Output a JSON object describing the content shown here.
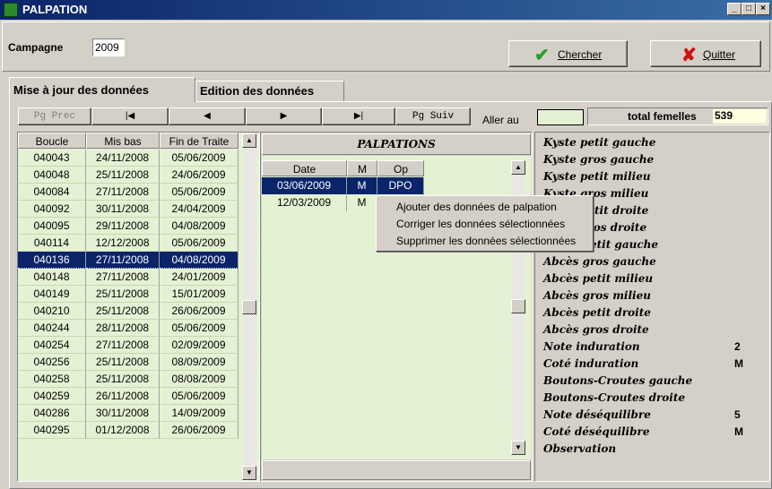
{
  "window": {
    "title": "PALPATION"
  },
  "toolbar": {
    "campagne_label": "Campagne",
    "campagne_value": "2009",
    "search_label": "Chercher",
    "quit_label": "Quitter"
  },
  "tabs": [
    {
      "label": "Mise à jour des données"
    },
    {
      "label": "Edition des données"
    }
  ],
  "nav": {
    "prev_page": "Pg Prec",
    "first": "|◀",
    "prev": "◀",
    "next": "▶",
    "last": "▶|",
    "next_page": "Pg Suiv",
    "goto_label": "Aller au",
    "goto_value": "",
    "total_label": "total femelles",
    "total_value": "539"
  },
  "animals": {
    "columns": [
      "Boucle",
      "Mis bas",
      "Fin de Traite"
    ],
    "rows": [
      [
        "040043",
        "24/11/2008",
        "05/06/2009"
      ],
      [
        "040048",
        "25/11/2008",
        "24/06/2009"
      ],
      [
        "040084",
        "27/11/2008",
        "05/06/2009"
      ],
      [
        "040092",
        "30/11/2008",
        "24/04/2009"
      ],
      [
        "040095",
        "29/11/2008",
        "04/08/2009"
      ],
      [
        "040114",
        "12/12/2008",
        "05/06/2009"
      ],
      [
        "040136",
        "27/11/2008",
        "04/08/2009"
      ],
      [
        "040148",
        "27/11/2008",
        "24/01/2009"
      ],
      [
        "040149",
        "25/11/2008",
        "15/01/2009"
      ],
      [
        "040210",
        "25/11/2008",
        "26/06/2009"
      ],
      [
        "040244",
        "28/11/2008",
        "05/06/2009"
      ],
      [
        "040254",
        "27/11/2008",
        "02/09/2009"
      ],
      [
        "040256",
        "25/11/2008",
        "08/09/2009"
      ],
      [
        "040258",
        "25/11/2008",
        "08/08/2009"
      ],
      [
        "040259",
        "26/11/2008",
        "05/06/2009"
      ],
      [
        "040286",
        "30/11/2008",
        "14/09/2009"
      ],
      [
        "040295",
        "01/12/2008",
        "26/06/2009"
      ]
    ],
    "selected_index": 6
  },
  "palpations": {
    "title": "PALPATIONS",
    "columns": [
      "Date",
      "M",
      "Op"
    ],
    "rows": [
      [
        "03/06/2009",
        "M",
        "DPO"
      ],
      [
        "12/03/2009",
        "M",
        ""
      ]
    ],
    "selected_index": 0
  },
  "context_menu": {
    "items": [
      "Ajouter des données de palpation",
      "Corriger les données sélectionnées",
      "Supprimer les données sélectionnées"
    ]
  },
  "details": {
    "fields": [
      {
        "label": "Kyste petit gauche",
        "value": ""
      },
      {
        "label": "Kyste gros gauche",
        "value": ""
      },
      {
        "label": "Kyste petit milieu",
        "value": ""
      },
      {
        "label": "Kyste gros milieu",
        "value": ""
      },
      {
        "label": "Kyste petit droite",
        "value": ""
      },
      {
        "label": "Kyste gros droite",
        "value": ""
      },
      {
        "label": "Abcès petit gauche",
        "value": ""
      },
      {
        "label": "Abcès gros gauche",
        "value": ""
      },
      {
        "label": "Abcès petit milieu",
        "value": ""
      },
      {
        "label": "Abcès gros milieu",
        "value": ""
      },
      {
        "label": "Abcès petit droite",
        "value": ""
      },
      {
        "label": "Abcès gros droite",
        "value": ""
      },
      {
        "label": "Note induration",
        "value": "2"
      },
      {
        "label": "Coté induration",
        "value": "M"
      },
      {
        "label": "Boutons-Croutes gauche",
        "value": ""
      },
      {
        "label": "Boutons-Croutes droite",
        "value": ""
      },
      {
        "label": "Note déséquilibre",
        "value": "5"
      },
      {
        "label": "Coté déséquilibre",
        "value": "M"
      },
      {
        "label": "Observation",
        "value": ""
      }
    ]
  },
  "colors": {
    "grid_bg": "#e4f2d4",
    "selection": "#0a246a",
    "titlebar": "#0a246a",
    "total_bg": "#ffffe1"
  }
}
